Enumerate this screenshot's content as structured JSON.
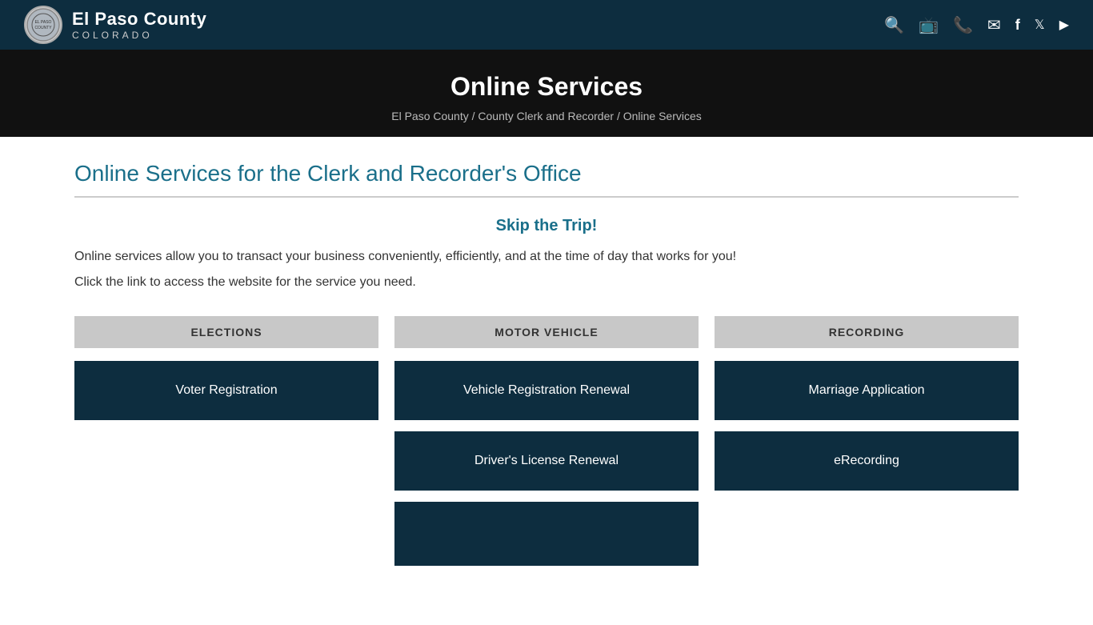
{
  "header": {
    "logo": {
      "county": "El Paso County",
      "state": "COLORADO"
    },
    "icons": [
      "search-icon",
      "tv-icon",
      "phone-icon",
      "mail-icon",
      "facebook-icon",
      "twitter-icon",
      "youtube-icon"
    ]
  },
  "banner": {
    "title": "Online Services",
    "breadcrumb": {
      "items": [
        "El Paso County",
        "County Clerk and Recorder",
        "Online Services"
      ],
      "separator": " / "
    }
  },
  "main": {
    "section_title": "Online Services for the Clerk and Recorder's Office",
    "skip_trip": "Skip the Trip!",
    "intro_line1": "Online services allow you to transact your business conveniently, efficiently, and at the time of day that works for you!",
    "intro_line2": "Click the link to access the website for the service you need.",
    "columns": [
      {
        "id": "elections",
        "header": "ELECTIONS",
        "buttons": [
          {
            "label": "Voter Registration"
          }
        ]
      },
      {
        "id": "motor-vehicle",
        "header": "MOTOR VEHICLE",
        "buttons": [
          {
            "label": "Vehicle Registration Renewal"
          },
          {
            "label": "Driver's License Renewal"
          },
          {
            "label": ""
          }
        ]
      },
      {
        "id": "recording",
        "header": "RECORDING",
        "buttons": [
          {
            "label": "Marriage Application"
          },
          {
            "label": "eRecording"
          }
        ]
      }
    ]
  }
}
